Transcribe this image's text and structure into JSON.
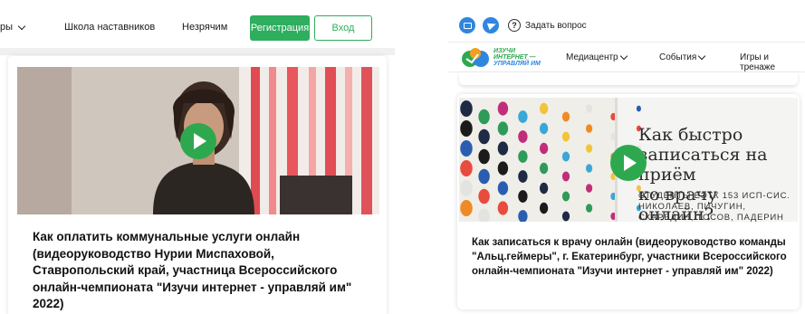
{
  "left_panel": {
    "nav": {
      "partial_item": "ры",
      "mentors_school": "Школа наставников",
      "unfair": "Незрячим",
      "register": "Регистрация",
      "login": "Вход"
    },
    "card": {
      "title": "Как оплатить коммунальные услуги онлайн (видеоруководство Нурии Миспаховой, Ставропольский край, участница Всероссийского онлайн-чемпионата \"Изучи интернет - управляй им\" 2022)"
    }
  },
  "right_panel": {
    "topbar": {
      "ask_question": "Задать вопрос"
    },
    "logo": {
      "line1": "ИЗУЧИ",
      "line2": "ИНТЕРНЕТ —",
      "line3": "УПРАВЛЯЙ ИМ"
    },
    "nav": {
      "mediacenter": "Медиацентр",
      "events": "События",
      "games": "Игры и тренаже"
    },
    "card": {
      "video_title": "Как быстро записаться на приём ко врачу онлайн?",
      "video_title_lines": [
        "Как быстро",
        "записаться на приём",
        "ко врачу онлайн?"
      ],
      "video_subtitle_lines": [
        "СТУДЕНТЫ ЕЭТК 153 ИСП-СИС.",
        "НИКОЛАЕВ, ПИЧУГИН,",
        "СКАРЕДИН, ТОСОВ, ПАДЕРИН"
      ],
      "title": "Как записаться к врачу онлайн (видеоруководство команды \"Альц.геймеры\", г. Екатеринбург, участники Всероссийского онлайн-чемпионата \"Изучи интернет - управляй им\" 2022)"
    }
  },
  "colors": {
    "accent_green": "#2eae5e",
    "play_green": "#2ea84f",
    "social_blue": "#2f86de"
  },
  "icons": [
    "chevron-down-icon",
    "play-icon",
    "mail-icon",
    "telegram-icon",
    "help-icon",
    "logo-icon"
  ]
}
